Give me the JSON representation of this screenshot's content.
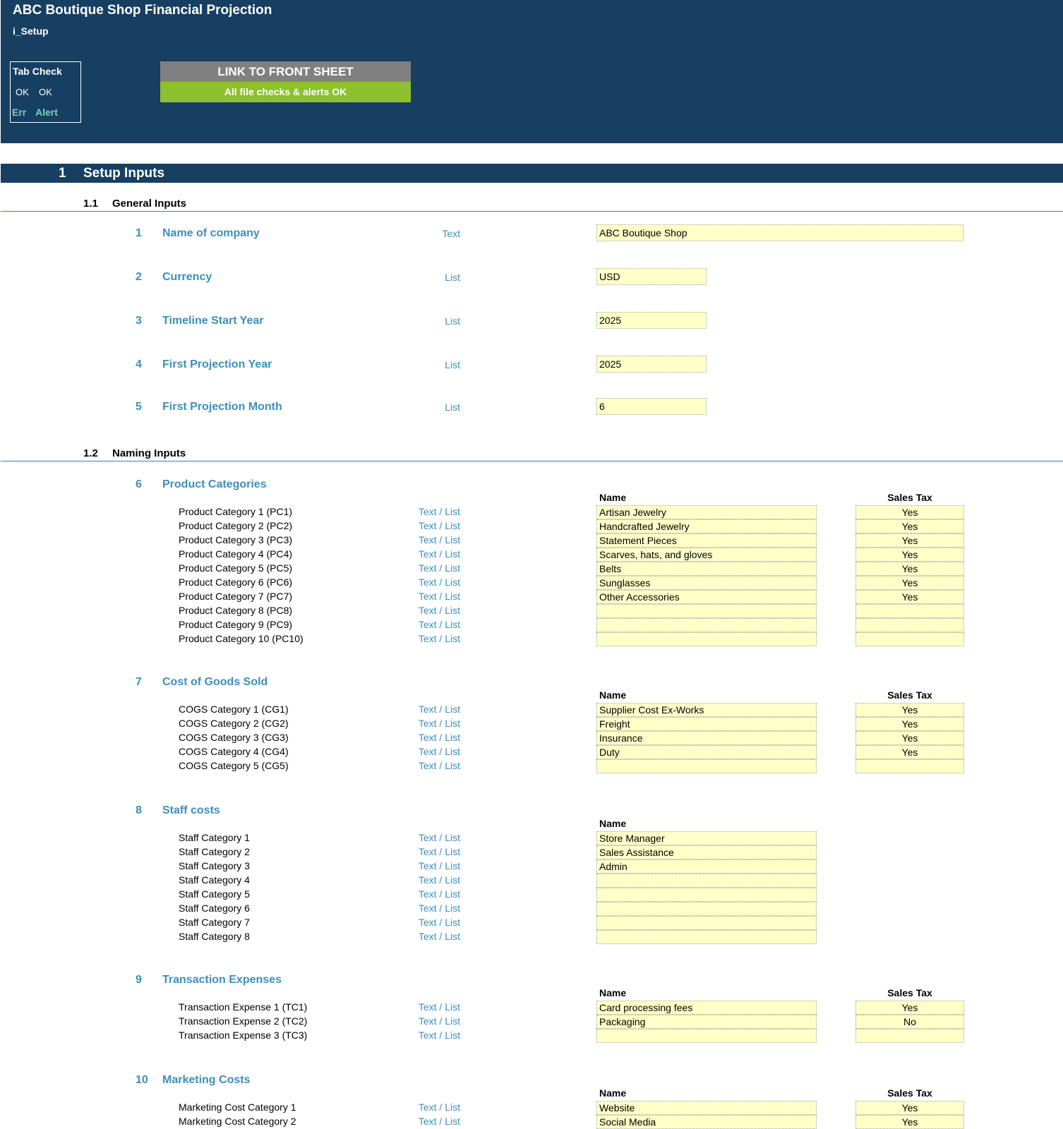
{
  "header": {
    "title": "ABC Boutique Shop Financial Projection",
    "sheet": "i_Setup",
    "tab_check": {
      "label": "Tab Check",
      "ok1": "OK",
      "ok2": "OK",
      "err": "Err",
      "alert": "Alert"
    },
    "link_button": "LINK TO FRONT SHEET",
    "status": "All file checks & alerts OK"
  },
  "section": {
    "num": "1",
    "title": "Setup Inputs"
  },
  "general": {
    "num": "1.1",
    "title": "General Inputs",
    "items": [
      {
        "num": "1",
        "label": "Name of company",
        "type": "Text",
        "value": "ABC Boutique Shop"
      },
      {
        "num": "2",
        "label": "Currency",
        "type": "List",
        "value": "USD"
      },
      {
        "num": "3",
        "label": "Timeline Start Year",
        "type": "List",
        "value": "2025"
      },
      {
        "num": "4",
        "label": "First Projection Year",
        "type": "List",
        "value": "2025"
      },
      {
        "num": "5",
        "label": "First Projection Month",
        "type": "List",
        "value": "6"
      }
    ]
  },
  "naming": {
    "num": "1.2",
    "title": "Naming Inputs",
    "col_name": "Name",
    "col_tax": "Sales Tax",
    "groups": [
      {
        "num": "6",
        "title": "Product Categories",
        "rows": [
          {
            "label": "Product Category 1 (PC1)",
            "type": "Text / List",
            "name": "Artisan Jewelry",
            "tax": "Yes"
          },
          {
            "label": "Product Category 2 (PC2)",
            "type": "Text / List",
            "name": "Handcrafted Jewelry",
            "tax": "Yes"
          },
          {
            "label": "Product Category 3 (PC3)",
            "type": "Text / List",
            "name": "Statement Pieces",
            "tax": "Yes"
          },
          {
            "label": "Product Category 4 (PC4)",
            "type": "Text / List",
            "name": "Scarves, hats, and gloves",
            "tax": "Yes"
          },
          {
            "label": "Product Category 5 (PC5)",
            "type": "Text / List",
            "name": "Belts",
            "tax": "Yes"
          },
          {
            "label": "Product Category 6 (PC6)",
            "type": "Text / List",
            "name": "Sunglasses",
            "tax": "Yes"
          },
          {
            "label": "Product Category 7 (PC7)",
            "type": "Text / List",
            "name": "Other Accessories",
            "tax": "Yes"
          },
          {
            "label": "Product Category 8 (PC8)",
            "type": "Text / List",
            "name": "",
            "tax": ""
          },
          {
            "label": "Product Category 9 (PC9)",
            "type": "Text / List",
            "name": "",
            "tax": ""
          },
          {
            "label": "Product Category 10 (PC10)",
            "type": "Text / List",
            "name": "",
            "tax": ""
          }
        ]
      },
      {
        "num": "7",
        "title": "Cost of Goods Sold",
        "rows": [
          {
            "label": "COGS Category 1 (CG1)",
            "type": "Text / List",
            "name": "Supplier Cost Ex-Works",
            "tax": "Yes"
          },
          {
            "label": "COGS Category 2 (CG2)",
            "type": "Text / List",
            "name": "Freight",
            "tax": "Yes"
          },
          {
            "label": "COGS Category 3 (CG3)",
            "type": "Text / List",
            "name": "Insurance",
            "tax": "Yes"
          },
          {
            "label": "COGS Category 4 (CG4)",
            "type": "Text / List",
            "name": "Duty",
            "tax": "Yes"
          },
          {
            "label": "COGS Category 5 (CG5)",
            "type": "Text / List",
            "name": "",
            "tax": ""
          }
        ]
      },
      {
        "num": "8",
        "title": "Staff costs",
        "rows": [
          {
            "label": "Staff Category 1",
            "type": "Text / List",
            "name": "Store Manager"
          },
          {
            "label": "Staff Category 2",
            "type": "Text / List",
            "name": "Sales Assistance"
          },
          {
            "label": "Staff Category 3",
            "type": "Text / List",
            "name": "Admin"
          },
          {
            "label": "Staff Category 4",
            "type": "Text / List",
            "name": ""
          },
          {
            "label": "Staff Category 5",
            "type": "Text / List",
            "name": ""
          },
          {
            "label": "Staff Category 6",
            "type": "Text / List",
            "name": ""
          },
          {
            "label": "Staff Category 7",
            "type": "Text / List",
            "name": ""
          },
          {
            "label": "Staff Category 8",
            "type": "Text / List",
            "name": ""
          }
        ]
      },
      {
        "num": "9",
        "title": "Transaction Expenses",
        "rows": [
          {
            "label": "Transaction Expense 1 (TC1)",
            "type": "Text / List",
            "name": "Card processing fees",
            "tax": "Yes"
          },
          {
            "label": "Transaction Expense 2 (TC2)",
            "type": "Text / List",
            "name": "Packaging",
            "tax": "No"
          },
          {
            "label": "Transaction Expense 3 (TC3)",
            "type": "Text / List",
            "name": "",
            "tax": ""
          }
        ]
      },
      {
        "num": "10",
        "title": "Marketing Costs",
        "rows": [
          {
            "label": "Marketing Cost Category 1",
            "type": "Text / List",
            "name": "Website",
            "tax": "Yes"
          },
          {
            "label": "Marketing Cost Category 2",
            "type": "Text / List",
            "name": "Social Media",
            "tax": "Yes"
          }
        ]
      }
    ]
  }
}
